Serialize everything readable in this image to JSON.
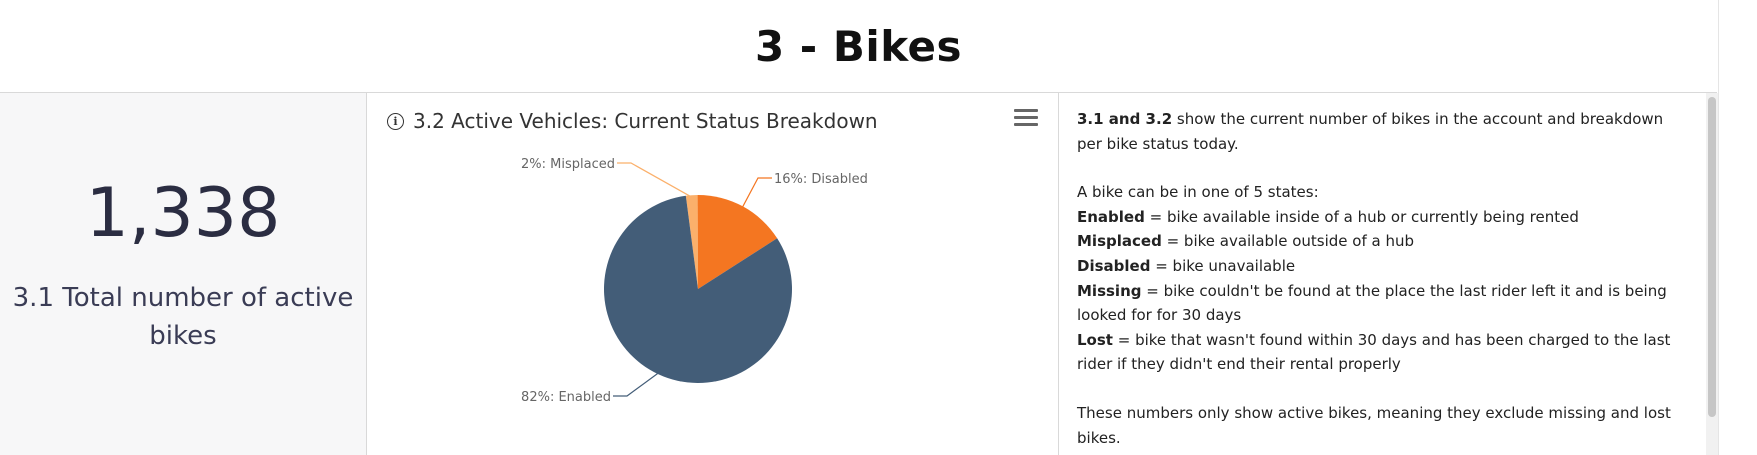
{
  "header": {
    "title": "3 - Bikes"
  },
  "kpi": {
    "value": "1,338",
    "label": "3.1 Total number of active bikes"
  },
  "pie_panel": {
    "title": "3.2 Active Vehicles: Current Status Breakdown",
    "info_icon": "info-icon",
    "menu_icon": "hamburger-menu-icon",
    "colors": {
      "enabled": "#435d78",
      "disabled": "#f47621",
      "misplaced": "#fbb06b"
    }
  },
  "chart_data": {
    "type": "pie",
    "title": "3.2 Active Vehicles: Current Status Breakdown",
    "slices": [
      {
        "label": "Misplaced",
        "value": 2,
        "display": "2%: Misplaced",
        "color": "#fbb06b"
      },
      {
        "label": "Disabled",
        "value": 16,
        "display": "16%: Disabled",
        "color": "#f47621"
      },
      {
        "label": "Enabled",
        "value": 82,
        "display": "82%: Enabled",
        "color": "#435d78"
      }
    ]
  },
  "description": {
    "intro_bold": "3.1 and 3.2",
    "intro_text": " show the current number of bikes in the account and breakdown per bike status today.",
    "states_intro": "A bike can be in one of 5 states:",
    "states": [
      {
        "name": "Enabled",
        "text": " = bike available inside of a hub or currently being rented"
      },
      {
        "name": "Misplaced",
        "text": " = bike available outside of a hub"
      },
      {
        "name": "Disabled",
        "text": " = bike unavailable"
      },
      {
        "name": "Missing",
        "text": " = bike couldn't be found at the place the last rider left it and is being looked for for 30 days"
      },
      {
        "name": "Lost",
        "text": " = bike that wasn't found within 30 days and has been charged to the last rider if they didn't end their rental properly"
      }
    ],
    "footer": "These numbers only show active bikes, meaning they exclude missing and lost bikes."
  }
}
